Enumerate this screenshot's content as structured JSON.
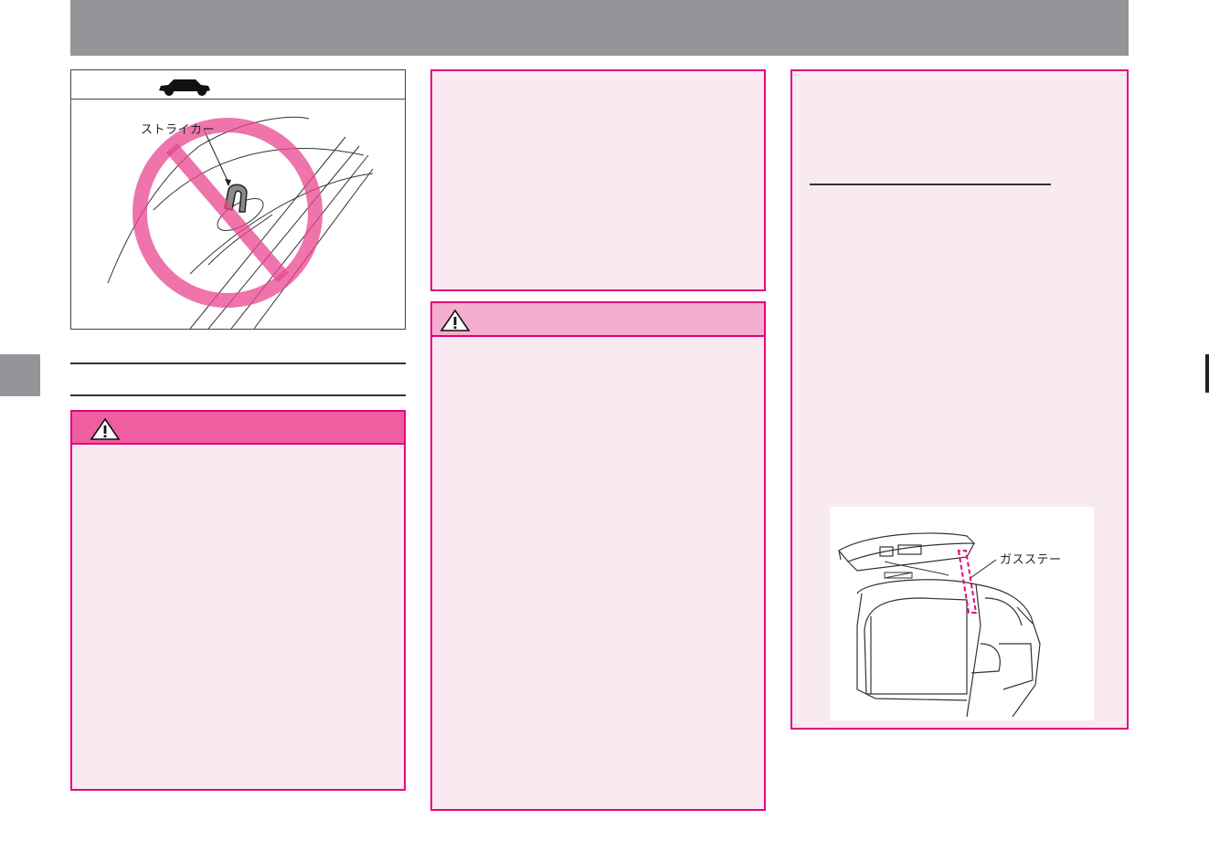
{
  "figure_striker": {
    "label": "ストライカー"
  },
  "figure_gas_stay": {
    "label": "ガスステー"
  },
  "colors": {
    "header_gray": "#939598",
    "magenta_border": "#e4007f",
    "caution_header": "#ee5ea0",
    "caution_header_light": "#f4aecf",
    "box_fill": "#f9e9f1"
  },
  "icons": {
    "car": "car-silhouette-icon",
    "warning": "warning-triangle-icon",
    "prohibited": "prohibition-circle-icon"
  }
}
